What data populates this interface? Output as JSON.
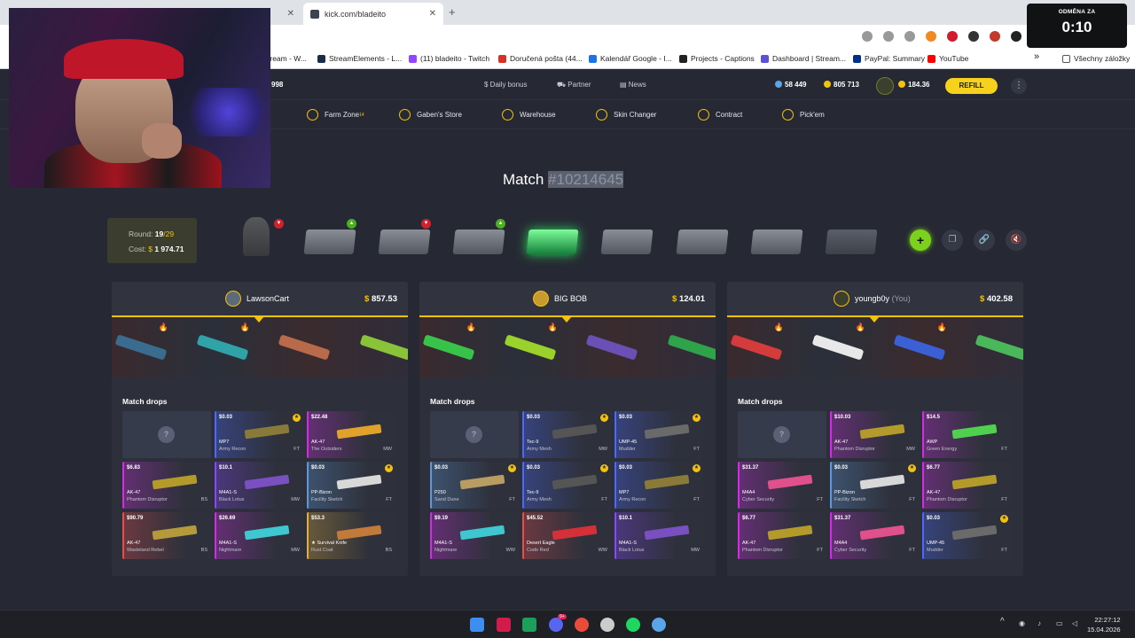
{
  "browser": {
    "tabs": [
      {
        "label": ""
      },
      {
        "label": "kick.com/bladeito"
      }
    ],
    "new_tab": "+",
    "bookmarks": [
      {
        "label": "tream - W...",
        "color": "#6b2df0"
      },
      {
        "label": "StreamElements - L...",
        "color": "#1c2b4a"
      },
      {
        "label": "(11) bladeito - Twitch",
        "color": "#9146ff"
      },
      {
        "label": "Doručená pošta (44...",
        "color": "#d93025"
      },
      {
        "label": "Kalendář Google - I...",
        "color": "#1a73e8"
      },
      {
        "label": "Projects - Captions",
        "color": "#222222"
      },
      {
        "label": "Dashboard | Stream...",
        "color": "#5a53d6"
      },
      {
        "label": "PayPal: Summary",
        "color": "#003087"
      },
      {
        "label": "YouTube",
        "color": "#ff0000"
      }
    ],
    "more_bookmarks": "»",
    "all_bookmarks": "Všechny záložky"
  },
  "site_header": {
    "left_count": "998",
    "daily_bonus": "Daily bonus",
    "partner": "Partner",
    "news": "News",
    "stat_1": "58 449",
    "stat_2": "805 713",
    "balance": "184.36",
    "refill": "REFILL",
    "menu": "⋮"
  },
  "nav": {
    "farm_zone": "Farm Zone",
    "farm_zone_sup": "14",
    "gabens_store": "Gaben's Store",
    "warehouse": "Warehouse",
    "skin_changer": "Skin Changer",
    "contract": "Contract",
    "pickem": "Pick'em"
  },
  "match": {
    "title_prefix": "Match",
    "id": "#10214645",
    "round_label": "Round:",
    "round_value": "19",
    "round_total": "/29",
    "cost_label": "Cost:",
    "cost_value": "1 974.71"
  },
  "cases": [
    {
      "badge": "down",
      "style": "figure"
    },
    {
      "badge": "up",
      "style": "normal"
    },
    {
      "badge": "down",
      "style": "normal"
    },
    {
      "badge": "up",
      "style": "normal"
    },
    {
      "badge": "",
      "style": "green"
    },
    {
      "badge": "",
      "style": "normal"
    },
    {
      "badge": "",
      "style": "normal"
    },
    {
      "badge": "",
      "style": "normal"
    },
    {
      "badge": "",
      "style": "faded"
    }
  ],
  "controls": {
    "add": "+",
    "copy": "❐",
    "link": "🔗",
    "mute": "🔇"
  },
  "players": [
    {
      "name": "LawsonCart",
      "you": "",
      "balance": "857.53",
      "drops_title": "Match drops",
      "cards": [
        {
          "empty": true
        },
        {
          "price": "$0.03",
          "weapon": "MP7",
          "skin": "Army Recon",
          "wear": "FT",
          "rarity": "#4b69ff",
          "gun": "#8a7a3a",
          "star": true
        },
        {
          "price": "$22.48",
          "weapon": "AK-47",
          "skin": "The Outsiders",
          "wear": "MW",
          "rarity": "#d32ce6",
          "gun": "#e0a22b",
          "star": false
        },
        {
          "price": "$6.83",
          "weapon": "AK-47",
          "skin": "Phantom Disruptor",
          "wear": "BS",
          "rarity": "#d32ce6",
          "gun": "#b39a2a",
          "star": false
        },
        {
          "price": "$10.1",
          "weapon": "M4A1-S",
          "skin": "Black Lotus",
          "wear": "MW",
          "rarity": "#8847ff",
          "gun": "#7a4fbf",
          "star": false
        },
        {
          "price": "$0.03",
          "weapon": "PP-Bizon",
          "skin": "Facility Sketch",
          "wear": "FT",
          "rarity": "#5e98d9",
          "gun": "#d8d8d8",
          "star": true
        },
        {
          "price": "$90.79",
          "weapon": "AK-47",
          "skin": "Wasteland Rebel",
          "wear": "BS",
          "rarity": "#eb4b4b",
          "gun": "#b49a3b",
          "star": false
        },
        {
          "price": "$26.69",
          "weapon": "M4A1-S",
          "skin": "Nightmare",
          "wear": "MW",
          "rarity": "#d32ce6",
          "gun": "#3ec6d1",
          "star": false
        },
        {
          "price": "$53.3",
          "weapon": "★ Survival Knife",
          "skin": "Rust Coat",
          "wear": "BS",
          "rarity": "#e4ae39",
          "gun": "#c27a3a",
          "star": false
        }
      ]
    },
    {
      "name": "BIG BOB",
      "you": "",
      "balance": "124.01",
      "drops_title": "Match drops",
      "cards": [
        {
          "empty": true
        },
        {
          "price": "$0.03",
          "weapon": "Tec-9",
          "skin": "Army Mesh",
          "wear": "MW",
          "rarity": "#4b69ff",
          "gun": "#555",
          "star": true
        },
        {
          "price": "$0.03",
          "weapon": "UMP-45",
          "skin": "Mudder",
          "wear": "FT",
          "rarity": "#4b69ff",
          "gun": "#6a6a6a",
          "star": true
        },
        {
          "price": "$0.03",
          "weapon": "P250",
          "skin": "Sand Dune",
          "wear": "FT",
          "rarity": "#5e98d9",
          "gun": "#b99c62",
          "star": true
        },
        {
          "price": "$0.03",
          "weapon": "Tec-9",
          "skin": "Army Mesh",
          "wear": "FT",
          "rarity": "#4b69ff",
          "gun": "#555",
          "star": true
        },
        {
          "price": "$0.03",
          "weapon": "MP7",
          "skin": "Army Recon",
          "wear": "FT",
          "rarity": "#4b69ff",
          "gun": "#8a7a3a",
          "star": true
        },
        {
          "price": "$9.19",
          "weapon": "M4A1-S",
          "skin": "Nightmare",
          "wear": "WW",
          "rarity": "#d32ce6",
          "gun": "#3ec6d1",
          "star": false
        },
        {
          "price": "$45.52",
          "weapon": "Desert Eagle",
          "skin": "Code Red",
          "wear": "WW",
          "rarity": "#eb4b4b",
          "gun": "#d3303a",
          "star": false
        },
        {
          "price": "$10.1",
          "weapon": "M4A1-S",
          "skin": "Black Lotus",
          "wear": "MW",
          "rarity": "#8847ff",
          "gun": "#7a4fbf",
          "star": false
        }
      ]
    },
    {
      "name": "youngb0y",
      "you": "(You)",
      "balance": "402.58",
      "drops_title": "Match drops",
      "cards": [
        {
          "empty": true
        },
        {
          "price": "$10.03",
          "weapon": "AK-47",
          "skin": "Phantom Disruptor",
          "wear": "MW",
          "rarity": "#d32ce6",
          "gun": "#b39a2a",
          "star": false
        },
        {
          "price": "$14.5",
          "weapon": "AWP",
          "skin": "Green Energy",
          "wear": "FT",
          "rarity": "#d32ce6",
          "gun": "#4fd14f",
          "star": false
        },
        {
          "price": "$31.37",
          "weapon": "M4A4",
          "skin": "Cyber Security",
          "wear": "FT",
          "rarity": "#d32ce6",
          "gun": "#e0508a",
          "star": false
        },
        {
          "price": "$0.03",
          "weapon": "PP-Bizon",
          "skin": "Facility Sketch",
          "wear": "FT",
          "rarity": "#5e98d9",
          "gun": "#d8d8d8",
          "star": true
        },
        {
          "price": "$6.77",
          "weapon": "AK-47",
          "skin": "Phantom Disruptor",
          "wear": "FT",
          "rarity": "#d32ce6",
          "gun": "#b39a2a",
          "star": false
        },
        {
          "price": "$6.77",
          "weapon": "AK-47",
          "skin": "Phantom Disruptor",
          "wear": "FT",
          "rarity": "#d32ce6",
          "gun": "#b39a2a",
          "star": false
        },
        {
          "price": "$31.37",
          "weapon": "M4A4",
          "skin": "Cyber Security",
          "wear": "FT",
          "rarity": "#d32ce6",
          "gun": "#e0508a",
          "star": false
        },
        {
          "price": "$0.03",
          "weapon": "UMP-45",
          "skin": "Mudder",
          "wear": "FT",
          "rarity": "#4b69ff",
          "gun": "#6a6a6a",
          "star": true
        }
      ]
    }
  ],
  "strips": [
    [
      {
        "gun": "#3a6c8f",
        "fire": true
      },
      {
        "gun": "#2fa3a8",
        "fire": true
      },
      {
        "gun": "#b86a4a",
        "fire": false
      },
      {
        "gun": "#8ac33a",
        "fire": false
      }
    ],
    [
      {
        "gun": "#37c24a",
        "fire": true
      },
      {
        "gun": "#9ad12a",
        "fire": true
      },
      {
        "gun": "#6a4fb5",
        "fire": false
      },
      {
        "gun": "#2fa34a",
        "fire": false
      }
    ],
    [
      {
        "gun": "#d43b3b",
        "fire": true
      },
      {
        "gun": "#e8e8e8",
        "fire": true
      },
      {
        "gun": "#3b5fd4",
        "fire": true
      },
      {
        "gun": "#4ab85a",
        "fire": false
      }
    ]
  ],
  "overlay": {
    "label": "ODMĚNA ZA",
    "value": "0:10"
  },
  "taskbar": {
    "icons": [
      "#3d8ef0",
      "#d11b4b",
      "#1c9f5a",
      "#5865f2",
      "#e94c3a",
      "#cccccc",
      "#1ed760",
      "#5aa4e8"
    ],
    "notif_badge": "9+",
    "tray_up": "^",
    "time": "22:27:12",
    "date": "15.04.2026"
  }
}
